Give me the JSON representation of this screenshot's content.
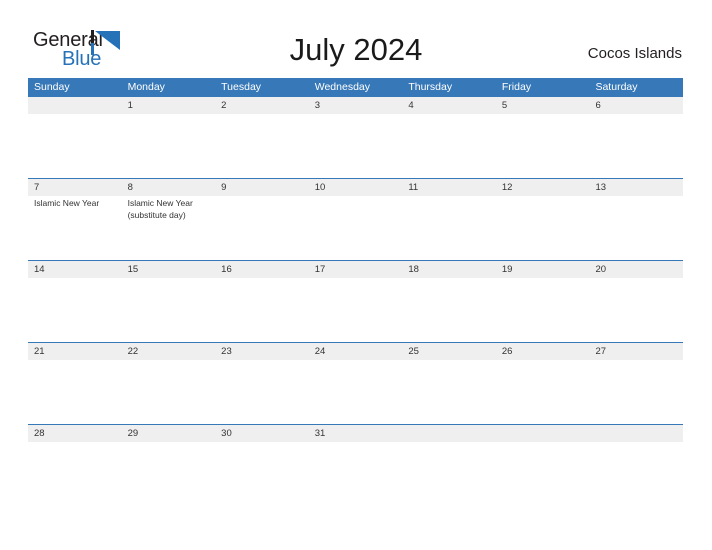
{
  "brand": {
    "name_top": "General",
    "name_bottom": "Blue",
    "flag_icon": "flag-triangle-icon",
    "accent_color": "#2672b8"
  },
  "header": {
    "title": "July 2024",
    "region": "Cocos Islands"
  },
  "colors": {
    "header_blue": "#3778b8",
    "date_band_gray": "#efefef",
    "text_dark": "#333333",
    "weekday_text": "#ffffff"
  },
  "calendar": {
    "weekdays": [
      "Sunday",
      "Monday",
      "Tuesday",
      "Wednesday",
      "Thursday",
      "Friday",
      "Saturday"
    ],
    "weeks": [
      {
        "days": [
          {
            "date": "",
            "events": []
          },
          {
            "date": "1",
            "events": []
          },
          {
            "date": "2",
            "events": []
          },
          {
            "date": "3",
            "events": []
          },
          {
            "date": "4",
            "events": []
          },
          {
            "date": "5",
            "events": []
          },
          {
            "date": "6",
            "events": []
          }
        ]
      },
      {
        "days": [
          {
            "date": "7",
            "events": [
              "Islamic New Year"
            ]
          },
          {
            "date": "8",
            "events": [
              "Islamic New Year (substitute day)"
            ]
          },
          {
            "date": "9",
            "events": []
          },
          {
            "date": "10",
            "events": []
          },
          {
            "date": "11",
            "events": []
          },
          {
            "date": "12",
            "events": []
          },
          {
            "date": "13",
            "events": []
          }
        ]
      },
      {
        "days": [
          {
            "date": "14",
            "events": []
          },
          {
            "date": "15",
            "events": []
          },
          {
            "date": "16",
            "events": []
          },
          {
            "date": "17",
            "events": []
          },
          {
            "date": "18",
            "events": []
          },
          {
            "date": "19",
            "events": []
          },
          {
            "date": "20",
            "events": []
          }
        ]
      },
      {
        "days": [
          {
            "date": "21",
            "events": []
          },
          {
            "date": "22",
            "events": []
          },
          {
            "date": "23",
            "events": []
          },
          {
            "date": "24",
            "events": []
          },
          {
            "date": "25",
            "events": []
          },
          {
            "date": "26",
            "events": []
          },
          {
            "date": "27",
            "events": []
          }
        ]
      },
      {
        "days": [
          {
            "date": "28",
            "events": []
          },
          {
            "date": "29",
            "events": []
          },
          {
            "date": "30",
            "events": []
          },
          {
            "date": "31",
            "events": []
          },
          {
            "date": "",
            "events": []
          },
          {
            "date": "",
            "events": []
          },
          {
            "date": "",
            "events": []
          }
        ]
      }
    ]
  }
}
